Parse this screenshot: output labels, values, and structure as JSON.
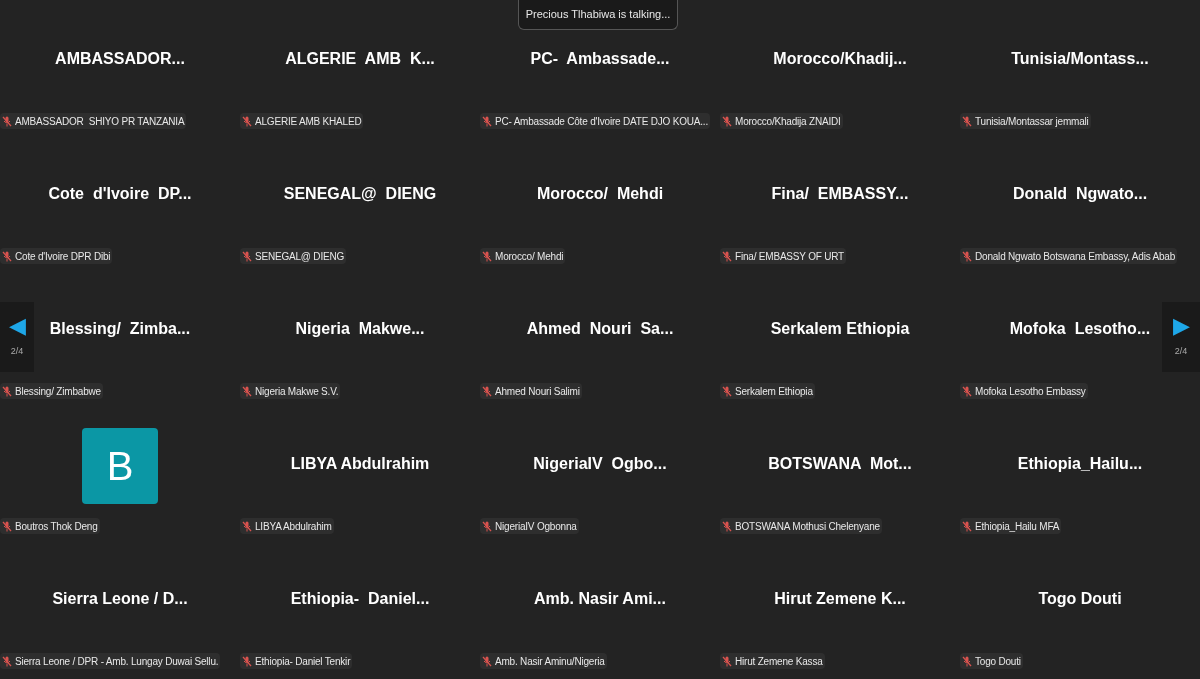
{
  "talking_banner": "Precious Tlhabiwa is talking...",
  "pager": {
    "left_arrow": "◀",
    "right_arrow": "▶",
    "left_page": "2/4",
    "right_page": "2/4"
  },
  "tiles": [
    {
      "kind": "name",
      "display": "AMBASSADOR...",
      "label": "AMBASSADOR  SHIYO PR TANZANIA",
      "muted": true
    },
    {
      "kind": "name",
      "display": "ALGERIE  AMB  K...",
      "label": "ALGERIE AMB KHALED",
      "muted": true
    },
    {
      "kind": "name",
      "display": "PC-  Ambassade...",
      "label": "PC- Ambassade Côte d'Ivoire DATE DJO KOUA...",
      "muted": true
    },
    {
      "kind": "name",
      "display": "Morocco/Khadij...",
      "label": "Morocco/Khadija ZNAIDI",
      "muted": true
    },
    {
      "kind": "name",
      "display": "Tunisia/Montass...",
      "label": "Tunisia/Montassar jemmali",
      "muted": true
    },
    {
      "kind": "name",
      "display": "Cote  d'Ivoire  DP...",
      "label": "Cote d'Ivoire DPR Dibi",
      "muted": true
    },
    {
      "kind": "name",
      "display": "SENEGAL@  DIENG",
      "label": "SENEGAL@ DIENG",
      "muted": true
    },
    {
      "kind": "name",
      "display": "Morocco/  Mehdi",
      "label": "Morocco/ Mehdi",
      "muted": true
    },
    {
      "kind": "name",
      "display": "Fina/  EMBASSY...",
      "label": "Fina/ EMBASSY OF URT",
      "muted": true
    },
    {
      "kind": "name",
      "display": "Donald  Ngwato...",
      "label": "Donald Ngwato Botswana Embassy, Adis Abab",
      "muted": true
    },
    {
      "kind": "name",
      "display": "Blessing/  Zimba...",
      "label": "Blessing/ Zimbabwe",
      "muted": true
    },
    {
      "kind": "name",
      "display": "Nigeria  Makwe...",
      "label": "Nigeria Makwe S.V.",
      "muted": true
    },
    {
      "kind": "name",
      "display": "Ahmed  Nouri  Sa...",
      "label": "Ahmed Nouri Salimi",
      "muted": true
    },
    {
      "kind": "name",
      "display": "Serkalem Ethiopia",
      "label": "Serkalem Ethiopia",
      "muted": true
    },
    {
      "kind": "name",
      "display": "Mofoka  Lesotho...",
      "label": "Mofoka Lesotho Embassy",
      "muted": true
    },
    {
      "kind": "avatar",
      "display": "B",
      "label": "Boutros Thok Deng",
      "muted": true
    },
    {
      "kind": "name",
      "display": "LIBYA Abdulrahim",
      "label": "LIBYA Abdulrahim",
      "muted": true
    },
    {
      "kind": "name",
      "display": "NigeriaIV  Ogbo...",
      "label": "NigeriaIV Ogbonna",
      "muted": true
    },
    {
      "kind": "name",
      "display": "BOTSWANA  Mot...",
      "label": "BOTSWANA Mothusi Chelenyane",
      "muted": true
    },
    {
      "kind": "name",
      "display": "Ethiopia_Hailu...",
      "label": "Ethiopia_Hailu MFA",
      "muted": true
    },
    {
      "kind": "name",
      "display": "Sierra Leone / D...",
      "label": "Sierra Leone / DPR - Amb. Lungay Duwai Sellu.",
      "muted": true
    },
    {
      "kind": "name",
      "display": "Ethiopia-  Daniel...",
      "label": "Ethiopia- Daniel Tenkir",
      "muted": true
    },
    {
      "kind": "name",
      "display": "Amb. Nasir Ami...",
      "label": "Amb. Nasir Aminu/Nigeria",
      "muted": true
    },
    {
      "kind": "name",
      "display": "Hirut Zemene K...",
      "label": "Hirut Zemene Kassa",
      "muted": true
    },
    {
      "kind": "name",
      "display": "Togo Douti",
      "label": "Togo Douti",
      "muted": true
    }
  ]
}
